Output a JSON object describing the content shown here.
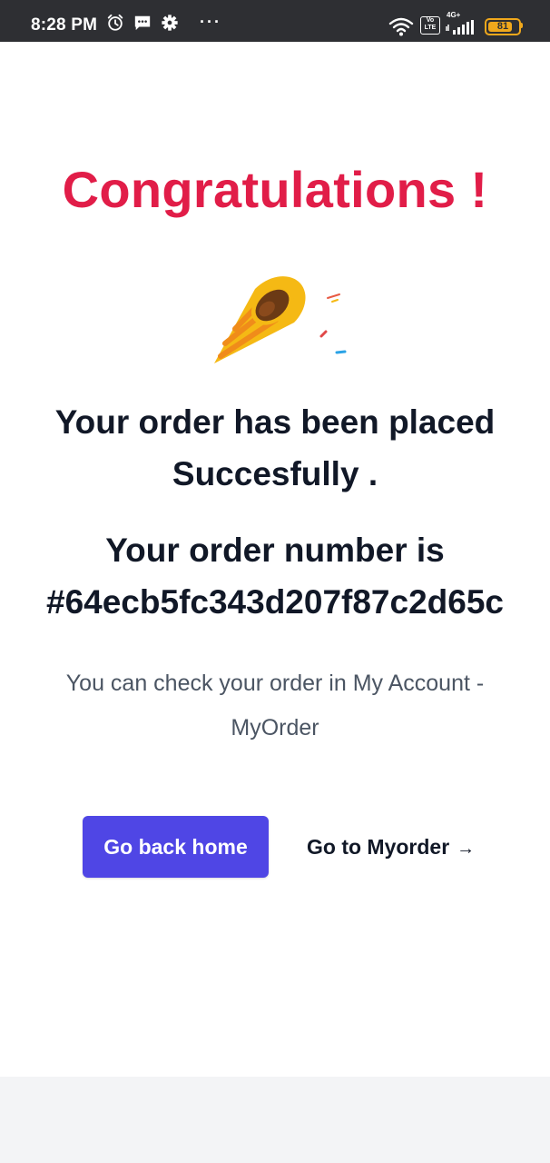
{
  "status_bar": {
    "time": "8:28 PM",
    "overflow": "···",
    "network_label": "4G+",
    "volte_label": "Vo LTE",
    "battery_level": "81",
    "icons": [
      "alarm-icon",
      "message-icon",
      "settings-icon",
      "wifi-icon",
      "volte-icon",
      "signal-icon",
      "battery-icon"
    ]
  },
  "main": {
    "title": "Congratulations !",
    "celebration_icon": "party-popper-icon",
    "order_placed_line1": "Your order has been placed",
    "order_placed_line2": "Succesfully .",
    "order_number_label": "Your order number is",
    "order_number": "#64ecb5fc343d207f87c2d65c",
    "helper_text": "You can check your order in My Account - MyOrder",
    "colors": {
      "title": "#e11d48",
      "primary_button": "#4f46e5",
      "heading": "#111827",
      "helper": "#4b5563"
    }
  },
  "actions": {
    "home_button": "Go back home",
    "myorder_link": "Go to Myorder",
    "myorder_arrow": "→"
  }
}
